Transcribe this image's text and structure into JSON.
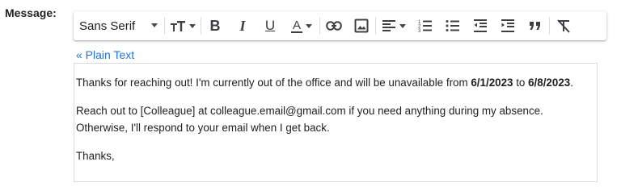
{
  "label": "Message:",
  "toolbar": {
    "font_family": "Sans Serif",
    "font_size_icon": "text-size-icon",
    "bold_glyph": "B",
    "italic_glyph": "I",
    "underline_glyph": "U",
    "text_color_glyph": "A",
    "icons": [
      "text-size-icon",
      "bold-icon",
      "italic-icon",
      "underline-icon",
      "text-color-icon",
      "link-icon",
      "image-icon",
      "align-icon",
      "numbered-list-icon",
      "bulleted-list-icon",
      "indent-less-icon",
      "indent-more-icon",
      "quote-icon",
      "remove-formatting-icon"
    ]
  },
  "plain_text_link": "« Plain Text",
  "body": {
    "line1_pre": "Thanks for reaching out! I'm currently out of the office and will be unavailable from ",
    "line1_date1": "6/1/2023",
    "line1_mid": " to ",
    "line1_date2": "6/8/2023",
    "line1_end": ".",
    "line2": "Reach out to [Colleague] at colleague.email@gmail.com if you need anything during my absence.",
    "line3": "Otherwise, I'll respond to your email when I get back.",
    "line4": "Thanks,"
  }
}
